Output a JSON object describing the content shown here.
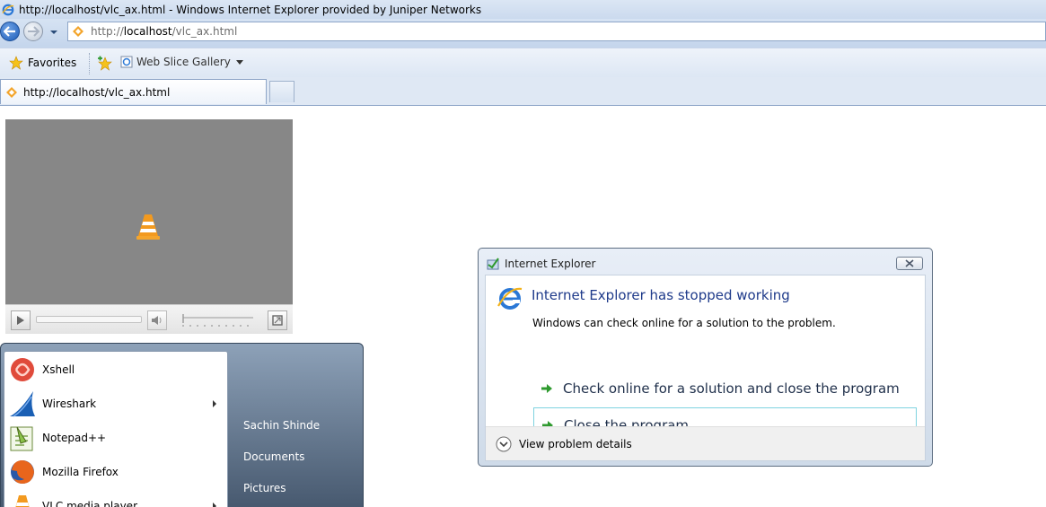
{
  "window": {
    "title": "http://localhost/vlc_ax.html - Windows Internet Explorer provided by Juniper Networks"
  },
  "address": {
    "url_prefix": "http://",
    "url_host": "localhost",
    "url_path": "/vlc_ax.html"
  },
  "favorites_bar": {
    "favorites_label": "Favorites",
    "web_slice_label": "Web Slice Gallery"
  },
  "tabs": [
    {
      "label": "http://localhost/vlc_ax.html",
      "active": true
    }
  ],
  "vlc_plugin": {
    "cone_icon": "vlc-cone-icon",
    "controls": [
      "play-icon",
      "speaker-icon",
      "fullscreen-icon"
    ]
  },
  "start_menu": {
    "programs": [
      {
        "label": "Xshell",
        "icon": "xshell-icon",
        "submenu": false
      },
      {
        "label": "Wireshark",
        "icon": "wireshark-icon",
        "submenu": true
      },
      {
        "label": "Notepad++",
        "icon": "notepadpp-icon",
        "submenu": false
      },
      {
        "label": "Mozilla Firefox",
        "icon": "firefox-icon",
        "submenu": false
      },
      {
        "label": "VLC media player",
        "icon": "vlc-icon",
        "submenu": true
      }
    ],
    "places": [
      "Sachin Shinde",
      "Documents",
      "Pictures"
    ]
  },
  "dialog": {
    "title": "Internet Explorer",
    "heading": "Internet Explorer has stopped working",
    "message": "Windows can check online for a solution to the problem.",
    "options": [
      {
        "label": "Check online for a solution and close the program",
        "focused": false
      },
      {
        "label": "Close the program",
        "focused": true
      }
    ],
    "details_label": "View problem details"
  },
  "colors": {
    "dialog_heading": "#1e3a8a",
    "vlc_video_bg": "#878787",
    "option_arrow": "#2e9a2e",
    "focus_border": "#7fd3e0"
  }
}
